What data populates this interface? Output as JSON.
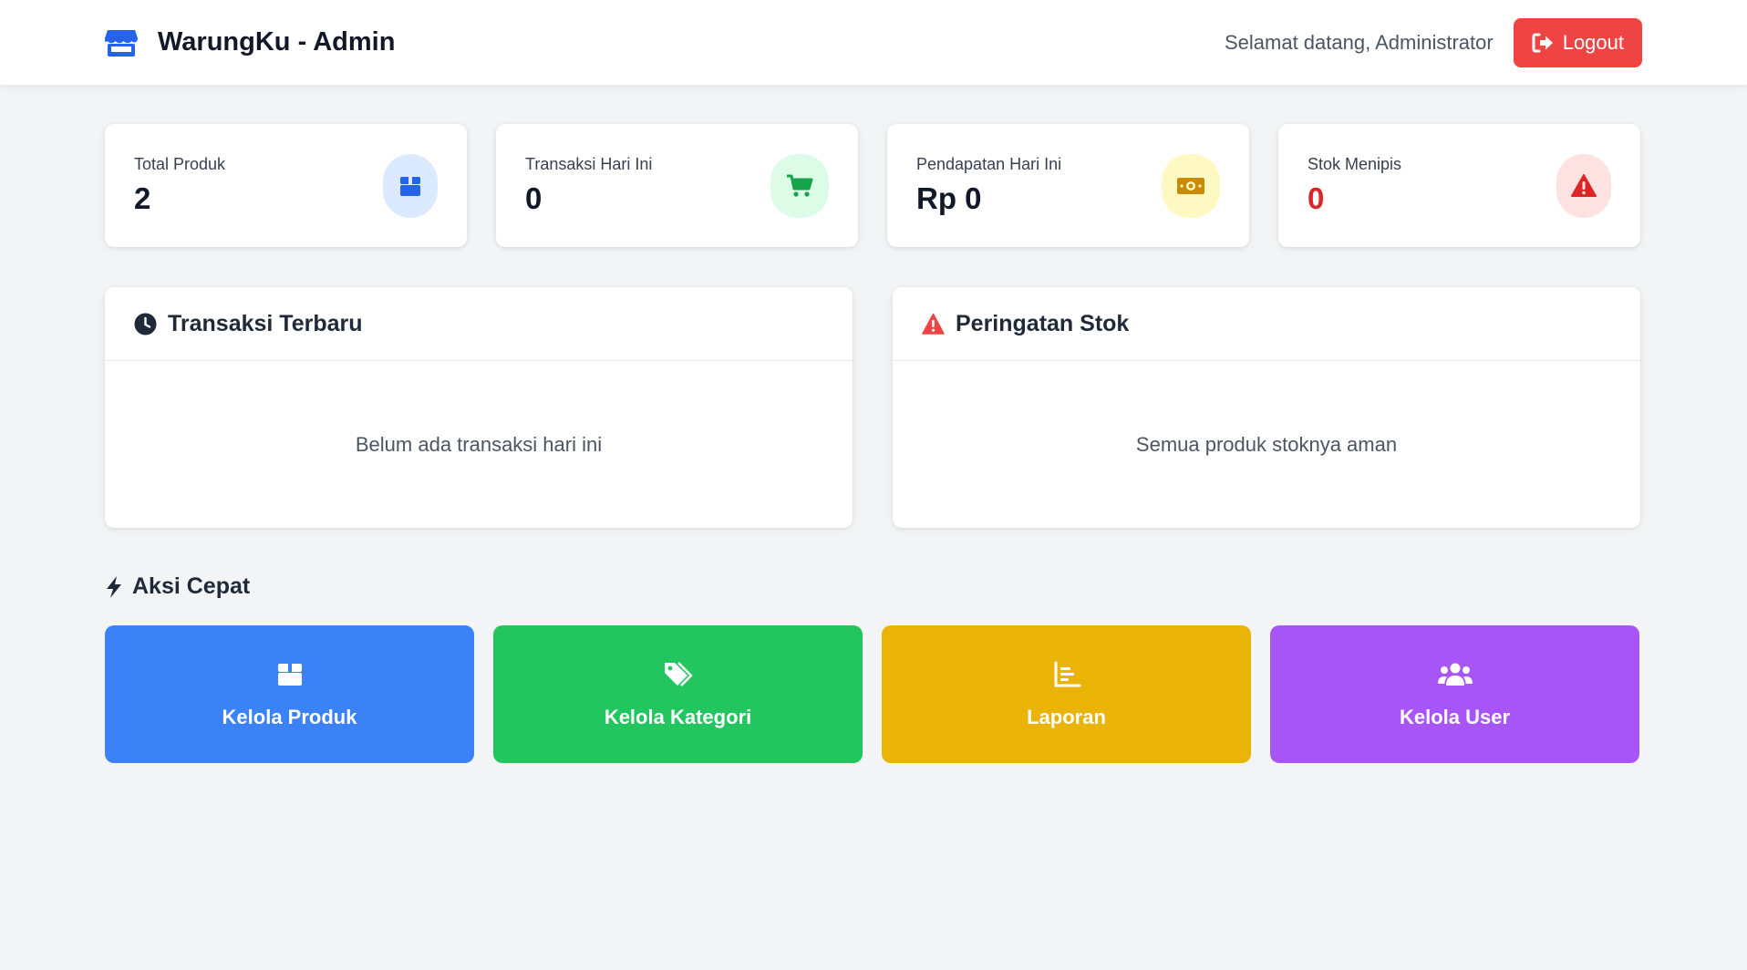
{
  "header": {
    "title": "WarungKu - Admin",
    "welcome": "Selamat datang, Administrator",
    "logout_label": "Logout"
  },
  "stats": [
    {
      "label": "Total Produk",
      "value": "2",
      "icon": "box-icon",
      "color": "#2563eb"
    },
    {
      "label": "Transaksi Hari Ini",
      "value": "0",
      "icon": "cart-icon",
      "color": "#16a34a"
    },
    {
      "label": "Pendapatan Hari Ini",
      "value": "Rp 0",
      "icon": "money-icon",
      "color": "#ca8a04"
    },
    {
      "label": "Stok Menipis",
      "value": "0",
      "icon": "warning-icon",
      "color": "#dc2626"
    }
  ],
  "panels": {
    "recent": {
      "title": "Transaksi Terbaru",
      "empty": "Belum ada transaksi hari ini",
      "icon": "clock-icon"
    },
    "stock": {
      "title": "Peringatan Stok",
      "empty": "Semua produk stoknya aman",
      "icon": "warning-icon"
    }
  },
  "quick_actions": {
    "title": "Aksi Cepat",
    "icon": "bolt-icon",
    "items": [
      {
        "label": "Kelola Produk",
        "icon": "box-icon",
        "color": "#3b82f6"
      },
      {
        "label": "Kelola Kategori",
        "icon": "tags-icon",
        "color": "#22c55e"
      },
      {
        "label": "Laporan",
        "icon": "chart-icon",
        "color": "#eab308"
      },
      {
        "label": "Kelola User",
        "icon": "users-icon",
        "color": "#a855f7"
      }
    ]
  }
}
